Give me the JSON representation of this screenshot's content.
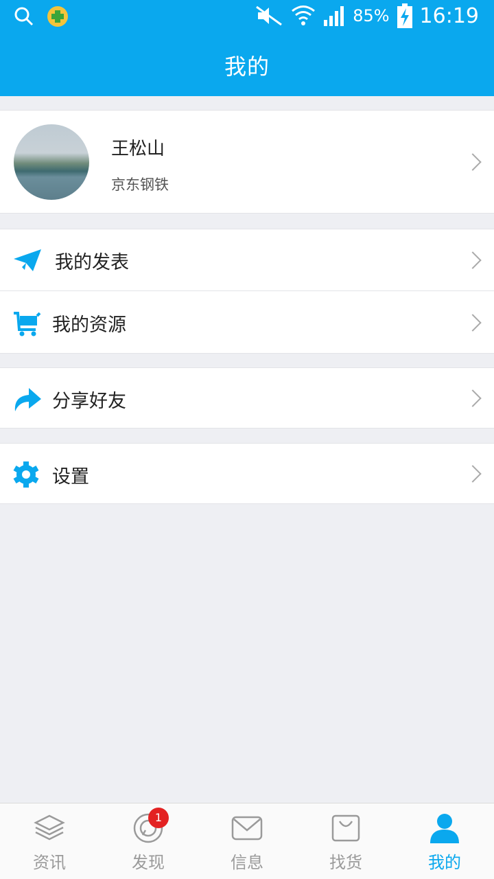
{
  "status_bar": {
    "battery_percent": "85%",
    "time": "16:19"
  },
  "header": {
    "title": "我的"
  },
  "profile": {
    "name": "王松山",
    "company": "京东钢铁"
  },
  "menu": {
    "posts": "我的发表",
    "resources": "我的资源",
    "share": "分享好友",
    "settings": "设置"
  },
  "bottom_nav": {
    "tabs": [
      {
        "label": "资讯",
        "icon": "layers-icon",
        "active": false
      },
      {
        "label": "发现",
        "icon": "discover-icon",
        "active": false,
        "badge": "1"
      },
      {
        "label": "信息",
        "icon": "mail-icon",
        "active": false
      },
      {
        "label": "找货",
        "icon": "bag-icon",
        "active": false
      },
      {
        "label": "我的",
        "icon": "user-icon",
        "active": true
      }
    ]
  },
  "colors": {
    "accent": "#0aa8ee",
    "badge": "#e32222"
  }
}
